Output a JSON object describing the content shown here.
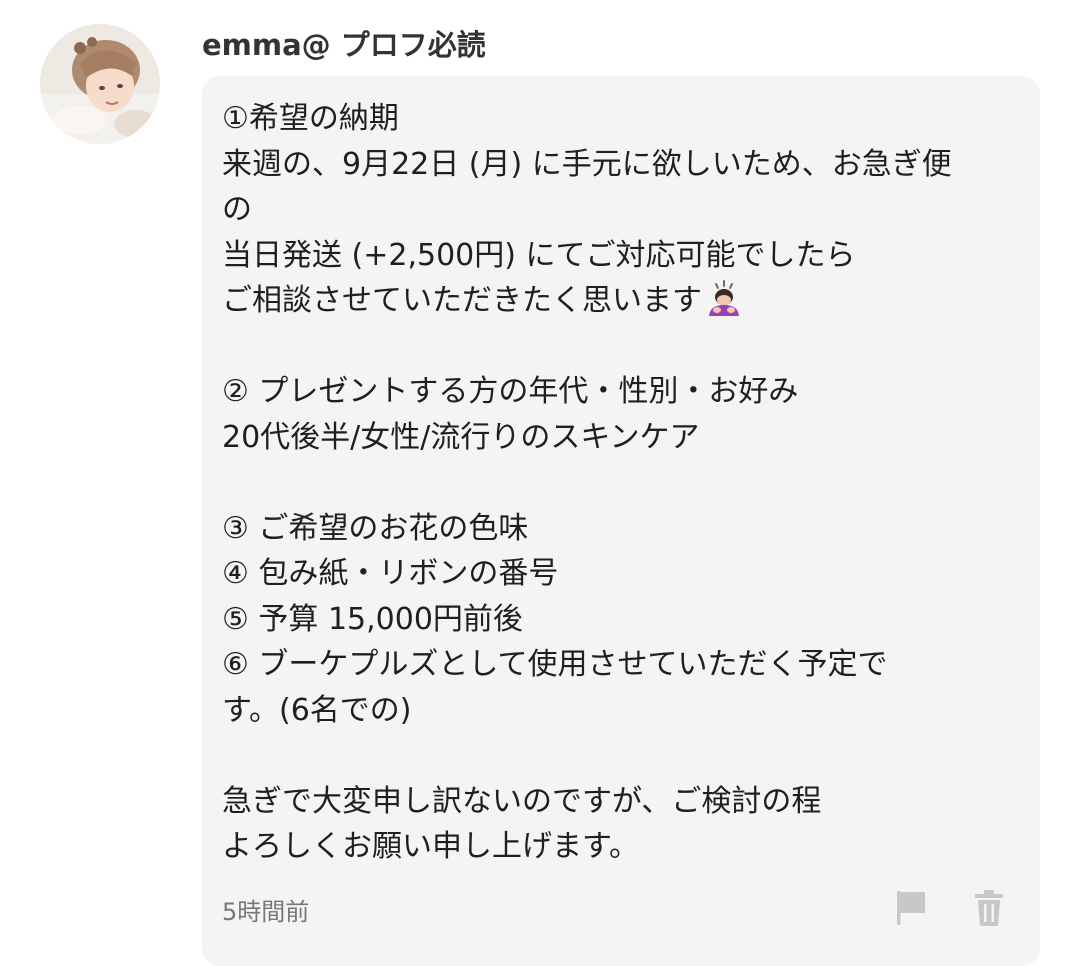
{
  "comment": {
    "username": "emma@ プロフ必読",
    "avatar_icon": "user-avatar-photo",
    "message_lines": [
      "①希望の納期",
      "来週の、9月22日 (月) に手元に欲しいため、お急ぎ便",
      "の",
      "当日発送 (+2,500円) にてご対応可能でしたら",
      "ご相談させていただきたく思います",
      "",
      "② プレゼントする方の年代・性別・お好み",
      "20代後半/女性/流行りのスキンケア",
      "",
      "③ ご希望のお花の色味",
      "④ 包み紙・リボンの番号",
      "⑤ 予算 15,000円前後",
      "⑥ ブーケプルズとして使用させていただく予定で",
      "す。(6名での)",
      "",
      "急ぎで大変申し訳ないのですが、ご検討の程",
      "よろしくお願い申し上げます。"
    ],
    "emoji_icon": "person-bowing-emoji",
    "timestamp": "5時間前",
    "actions": {
      "flag_icon": "flag-icon",
      "delete_icon": "trash-icon"
    }
  },
  "colors": {
    "bubble_background": "#f4f4f4",
    "text": "#1f1f1f",
    "meta_text": "#777777",
    "action_icons": "#c8c8c8"
  }
}
